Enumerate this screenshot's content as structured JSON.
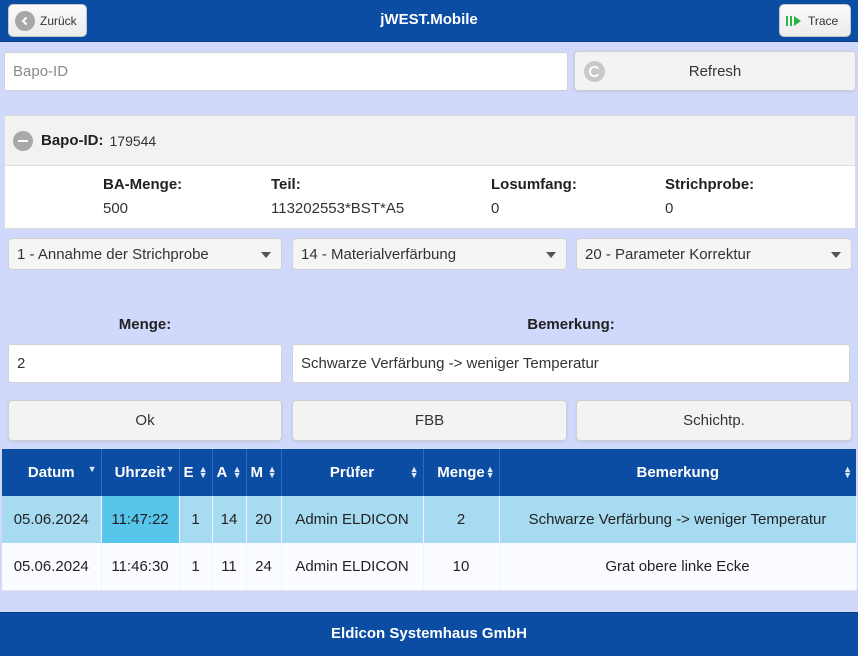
{
  "header": {
    "title": "jWEST.Mobile",
    "back_label": "Zurück",
    "trace_label": "Trace"
  },
  "search": {
    "placeholder": "Bapo-ID",
    "value": "",
    "refresh_label": "Refresh"
  },
  "panel": {
    "id_label": "Bapo-ID:",
    "id_value": "179544",
    "fields": [
      {
        "label": "BA-Menge:",
        "value": "500"
      },
      {
        "label": "Teil:",
        "value": "113202553*BST*A5"
      },
      {
        "label": "Losumfang:",
        "value": "0"
      },
      {
        "label": "Strichprobe:",
        "value": "0"
      }
    ]
  },
  "selects": [
    {
      "value": "1 - Annahme der Strichprobe"
    },
    {
      "value": "14 - Materialverfärbung"
    },
    {
      "value": "20 - Parameter Korrektur"
    }
  ],
  "form": {
    "menge_label": "Menge:",
    "menge_value": "2",
    "bemerkung_label": "Bemerkung:",
    "bemerkung_value": "Schwarze Verfärbung -> weniger Temperatur"
  },
  "actions": {
    "ok_label": "Ok",
    "fbb_label": "FBB",
    "schicht_label": "Schichtp."
  },
  "table": {
    "columns": [
      "Datum",
      "Uhrzeit",
      "E",
      "A",
      "M",
      "Prüfer",
      "Menge",
      "Bemerkung"
    ],
    "rows": [
      [
        "05.06.2024",
        "11:47:22",
        "1",
        "14",
        "20",
        "Admin ELDICON",
        "2",
        "Schwarze Verfärbung -> weniger Temperatur"
      ],
      [
        "05.06.2024",
        "11:46:30",
        "1",
        "11",
        "24",
        "Admin ELDICON",
        "10",
        "Grat obere linke Ecke"
      ]
    ]
  },
  "footer": {
    "text": "Eldicon Systemhaus GmbH"
  },
  "colors": {
    "brand": "#0a4da3",
    "background": "#d0d8fb",
    "selected_row": "#a7dbf1",
    "selected_cell": "#57c6ea"
  }
}
